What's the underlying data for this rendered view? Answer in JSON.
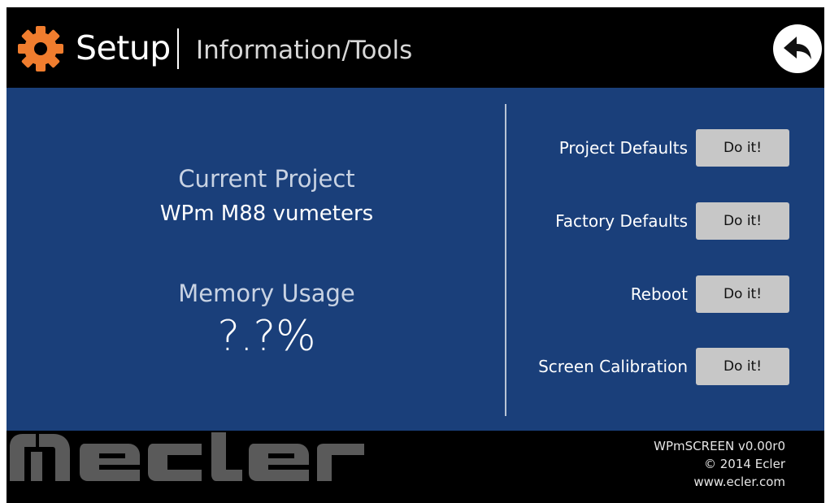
{
  "header": {
    "title": "Setup",
    "subtitle": "Information/Tools",
    "gear_icon": "gear-icon",
    "back_icon": "back-arrow-icon",
    "accent_color": "#f07d2e"
  },
  "info": {
    "project_label": "Current Project",
    "project_value": "WPm M88 vumeters",
    "memory_label": "Memory Usage",
    "memory_value": "?.?%"
  },
  "tools": [
    {
      "label": "Project Defaults",
      "button": "Do it!"
    },
    {
      "label": "Factory Defaults",
      "button": "Do it!"
    },
    {
      "label": "Reboot",
      "button": "Do it!"
    },
    {
      "label": "Screen Calibration",
      "button": "Do it!"
    }
  ],
  "footer": {
    "logo": "ecler",
    "version": "WPmSCREEN v0.00r0",
    "copyright": "© 2014 Ecler",
    "website": "www.ecler.com"
  },
  "colors": {
    "panel": "#1a3f7a",
    "button": "#c7c7c7",
    "logo": "#5a5a5a"
  }
}
